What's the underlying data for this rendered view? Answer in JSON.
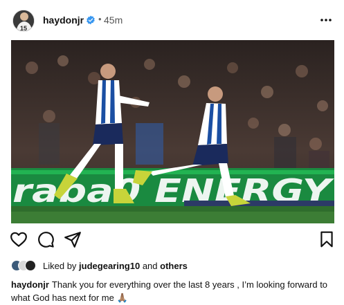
{
  "post": {
    "username": "haydonjr",
    "separator": "•",
    "time_ago": "45m",
    "image_banner_text": "raba0 ENERGY",
    "liked_prefix": "Liked by",
    "liked_user": "judegearing10",
    "liked_and": "and",
    "liked_others": "others",
    "caption": "Thank you for everything over the last 8 years , I’m looking forward to what God has next for me",
    "caption_emoji": "🙏🏽"
  },
  "icons": {
    "verified": "verified-badge-icon",
    "more": "more-options-icon",
    "like": "heart-icon",
    "comment": "comment-icon",
    "share": "send-icon",
    "save": "bookmark-icon"
  },
  "colors": {
    "verified_blue": "#3897f0",
    "banner_green": "#1fa34a",
    "kit_blue": "#1b4fa3",
    "text": "#111111",
    "muted": "#555555"
  }
}
